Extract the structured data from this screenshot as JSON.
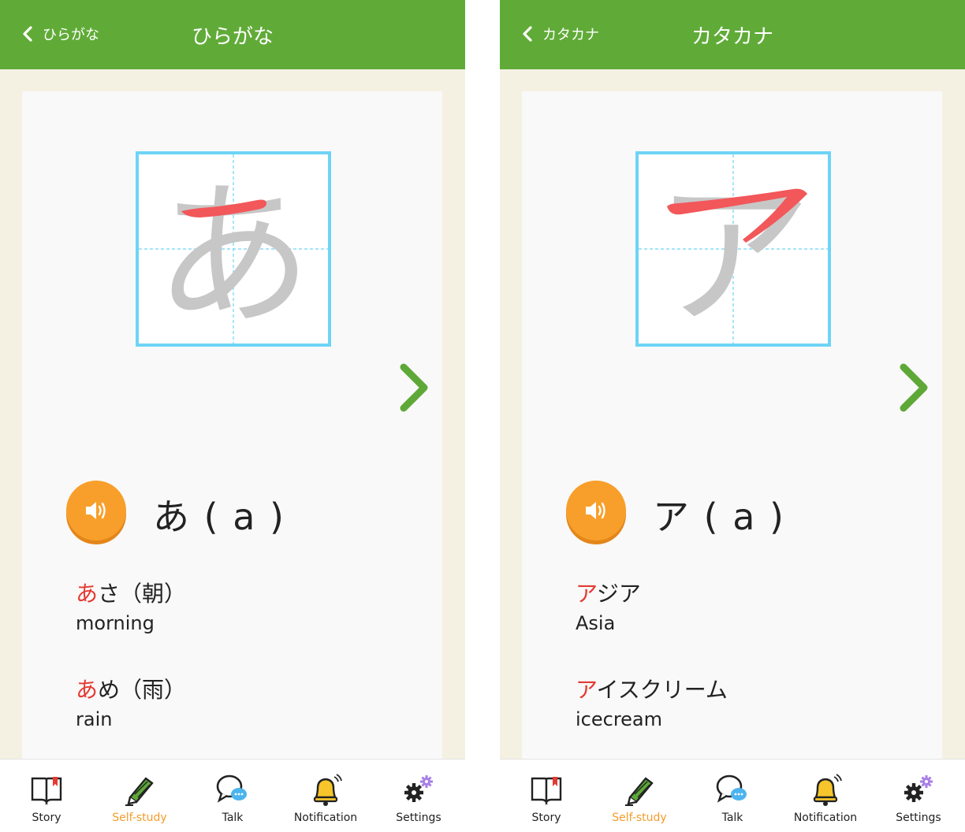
{
  "colors": {
    "header": "#60ab38",
    "accent_orange": "#f89f2b",
    "highlight_red": "#e53a32",
    "box_border": "#6ed4f6",
    "active_tab": "#f39c2b"
  },
  "tabs": [
    {
      "label": "Story",
      "icon": "book-icon"
    },
    {
      "label": "Self-study",
      "icon": "pencil-icon"
    },
    {
      "label": "Talk",
      "icon": "chat-bubble-icon"
    },
    {
      "label": "Notification",
      "icon": "bell-icon"
    },
    {
      "label": "Settings",
      "icon": "gear-icon"
    }
  ],
  "active_tab": "Self-study",
  "screens": [
    {
      "back_label": "ひらがな",
      "title": "ひらがな",
      "character": "あ",
      "main_kana": "あ ( a )",
      "examples": [
        {
          "highlight": "あ",
          "rest": "さ（朝）",
          "meaning": "morning"
        },
        {
          "highlight": "あ",
          "rest": "め（雨）",
          "meaning": "rain"
        }
      ]
    },
    {
      "back_label": "カタカナ",
      "title": "カタカナ",
      "character": "ア",
      "main_kana": "ア ( a )",
      "examples": [
        {
          "highlight": "ア",
          "rest": "ジア",
          "meaning": "Asia"
        },
        {
          "highlight": "ア",
          "rest": "イスクリーム",
          "meaning": "icecream"
        }
      ]
    }
  ]
}
